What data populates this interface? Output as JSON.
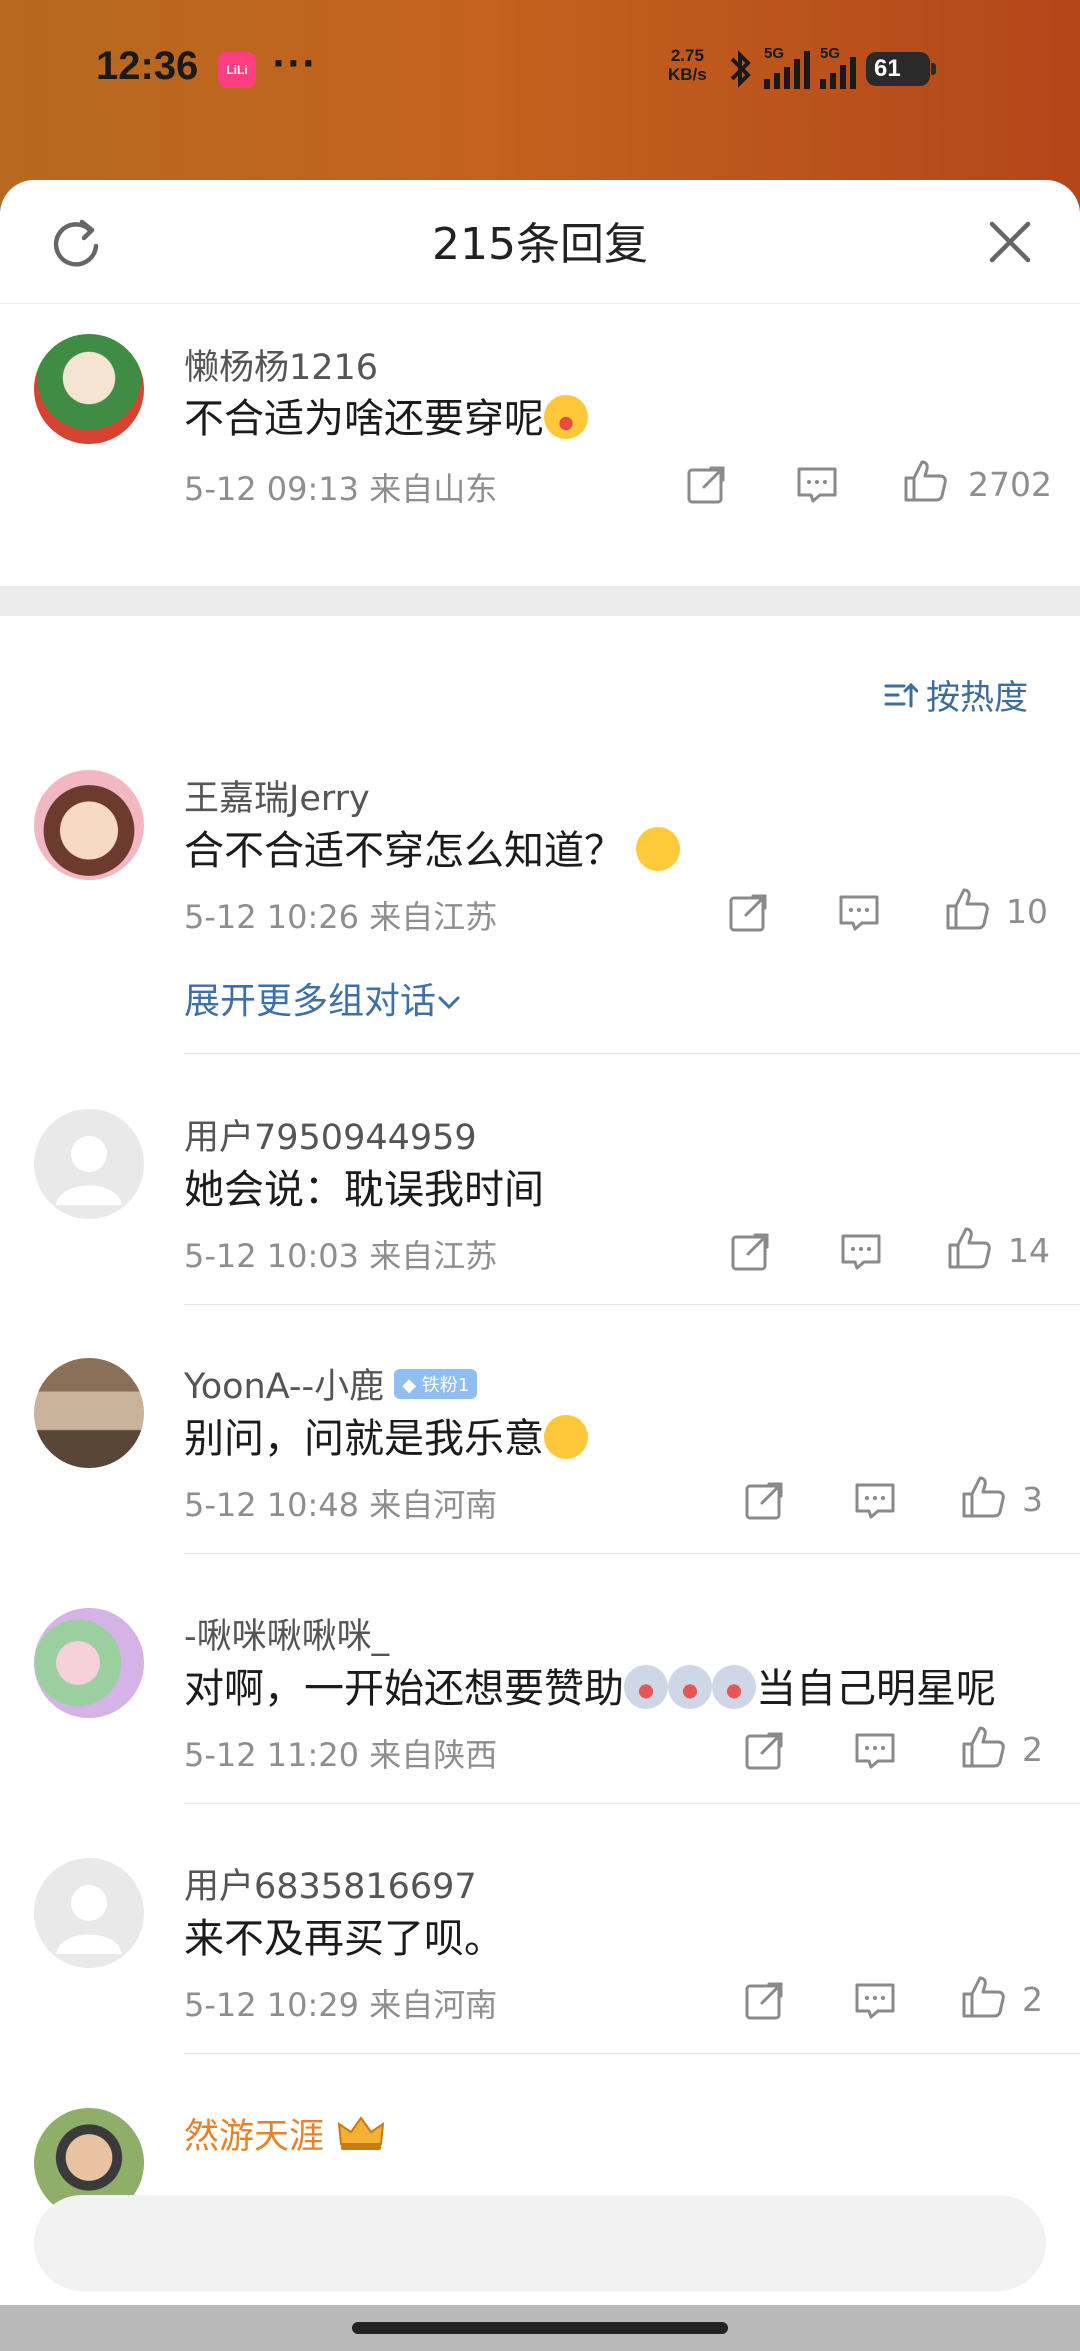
{
  "status_bar": {
    "time": "12:36",
    "app_badge": "LiLi",
    "dots": "···",
    "net_speed_value": "2.75",
    "net_speed_unit": "KB/s",
    "signal1_label": "5G",
    "signal2_label": "5G",
    "battery": "61"
  },
  "sheet": {
    "title": "215条回复"
  },
  "root_comment": {
    "username": "懒杨杨1216",
    "content": "不合适为啥还要穿呢",
    "meta": "5-12 09:13  来自山东",
    "likes": "2702"
  },
  "sort": {
    "label": "按热度"
  },
  "replies": [
    {
      "username": "王嘉瑞Jerry",
      "content": "合不合适不穿怎么知道？",
      "meta": "5-12 10:26  来自江苏",
      "likes": "10",
      "expand": "展开更多组对话"
    },
    {
      "username": "用户7950944959",
      "content": "她会说：耽误我时间",
      "meta": "5-12 10:03  来自江苏",
      "likes": "14"
    },
    {
      "username": "YoonA--小鹿",
      "badge": "铁粉1",
      "content": "别问，问就是我乐意",
      "meta": "5-12 10:48  来自河南",
      "likes": "3"
    },
    {
      "username": "-啾咪啾啾咪_",
      "content_a": "对啊，一开始还想要赞助",
      "content_b": "当自己明星呢",
      "meta": "5-12 11:20  来自陕西",
      "likes": "2"
    },
    {
      "username": "用户6835816697",
      "content": "来不及再买了呗。",
      "meta": "5-12 10:29  来自河南",
      "likes": "2"
    },
    {
      "username": "然游天涯"
    }
  ],
  "colors": {
    "link_blue": "#3e6fa6",
    "meta_grey": "#8e8e8e",
    "vip_orange": "#e8822a"
  },
  "icons": [
    "refresh-icon",
    "close-icon",
    "share-icon",
    "reply-icon",
    "like-icon",
    "sort-icon",
    "chevron-down-icon"
  ]
}
